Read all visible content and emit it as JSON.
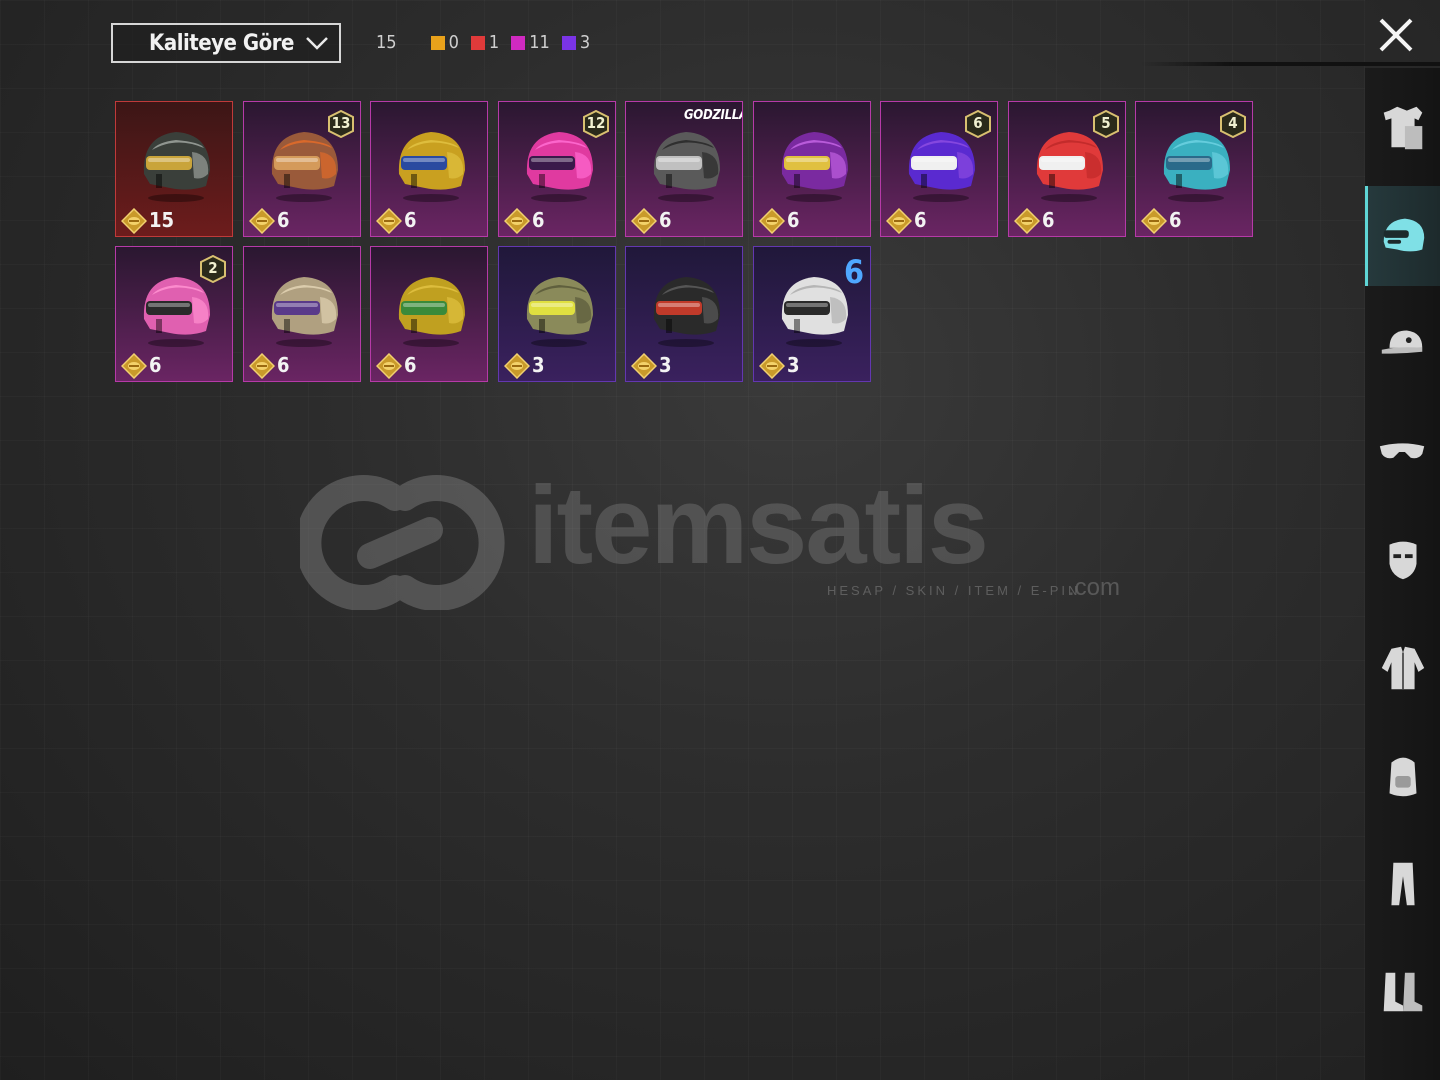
{
  "sort": {
    "label": "Kaliteye Göre"
  },
  "counts": {
    "total": "15",
    "groups": [
      {
        "color": "#e9a21b",
        "count": "0"
      },
      {
        "color": "#e03a3a",
        "count": "1"
      },
      {
        "color": "#d02ac0",
        "count": "11"
      },
      {
        "color": "#7a34e6",
        "count": "3"
      }
    ]
  },
  "items": [
    {
      "price": "15",
      "quality": "red",
      "badge": "",
      "helmet": "winged",
      "colors": [
        "#3a3f3a",
        "#c9a43a",
        "#9aa09a"
      ]
    },
    {
      "price": "6",
      "quality": "pink",
      "badge": "13",
      "helmet": "steampunk",
      "colors": [
        "#9a5a3a",
        "#d49a5a",
        "#e06a2a"
      ]
    },
    {
      "price": "6",
      "quality": "pink",
      "badge": "",
      "helmet": "pharaoh",
      "colors": [
        "#c9a020",
        "#2a4aa0",
        "#e0c040"
      ]
    },
    {
      "price": "6",
      "quality": "pink",
      "badge": "12",
      "helmet": "rabbit",
      "colors": [
        "#e03aa0",
        "#3a1a4a",
        "#ff6ad0"
      ]
    },
    {
      "price": "6",
      "quality": "pink",
      "badge": "",
      "brand": "GODZILLA",
      "helmet": "godzilla",
      "colors": [
        "#5a5a5a",
        "#c0c0c0",
        "#2a2a2a"
      ]
    },
    {
      "price": "6",
      "quality": "pink",
      "badge": "",
      "helmet": "monster",
      "colors": [
        "#7a2aa0",
        "#e0c040",
        "#c060e0"
      ]
    },
    {
      "price": "6",
      "quality": "pink",
      "badge": "6",
      "helmet": "racer",
      "colors": [
        "#5a2ad0",
        "#f0f0f0",
        "#8a4ae0"
      ]
    },
    {
      "price": "6",
      "quality": "pink",
      "badge": "5",
      "helmet": "rider",
      "colors": [
        "#e03a3a",
        "#f0f0f0",
        "#c02a2a"
      ]
    },
    {
      "price": "6",
      "quality": "pink",
      "badge": "4",
      "helmet": "zombie",
      "colors": [
        "#3ab0c0",
        "#2a6a8a",
        "#6ad0e0"
      ]
    },
    {
      "price": "6",
      "quality": "pink",
      "badge": "2",
      "helmet": "pinkvisor",
      "colors": [
        "#e060b0",
        "#2a2a2a",
        "#ff90d0"
      ]
    },
    {
      "price": "6",
      "quality": "pink",
      "badge": "",
      "helmet": "tiger",
      "colors": [
        "#b0a080",
        "#5a3a8a",
        "#e0d0b0"
      ]
    },
    {
      "price": "6",
      "quality": "pink",
      "badge": "",
      "helmet": "golden",
      "colors": [
        "#c0a020",
        "#3a8a3a",
        "#e0c040"
      ]
    },
    {
      "price": "3",
      "quality": "purple",
      "badge": "",
      "helmet": "camo",
      "colors": [
        "#8a8a5a",
        "#e0e040",
        "#5a5a3a"
      ]
    },
    {
      "price": "3",
      "quality": "purple",
      "badge": "",
      "helmet": "redstripe",
      "colors": [
        "#2a2a2a",
        "#c03a2a",
        "#5a5a5a"
      ]
    },
    {
      "price": "3",
      "quality": "purple",
      "badge": "",
      "six": "6",
      "helmet": "white",
      "colors": [
        "#e0e0e0",
        "#2a2a2a",
        "#b0b0b0"
      ]
    }
  ],
  "watermark": {
    "text": "itemsatis",
    "sub": "HESAP / SKIN / ITEM / E-PIN",
    "com": ".com"
  },
  "sidebar": [
    {
      "name": "outfit-icon",
      "active": false
    },
    {
      "name": "helmet-icon",
      "active": true
    },
    {
      "name": "cap-icon",
      "active": false
    },
    {
      "name": "glasses-icon",
      "active": false
    },
    {
      "name": "mask-icon",
      "active": false
    },
    {
      "name": "jacket-icon",
      "active": false
    },
    {
      "name": "backpack-icon",
      "active": false
    },
    {
      "name": "pants-icon",
      "active": false
    },
    {
      "name": "boots-icon",
      "active": false
    }
  ]
}
